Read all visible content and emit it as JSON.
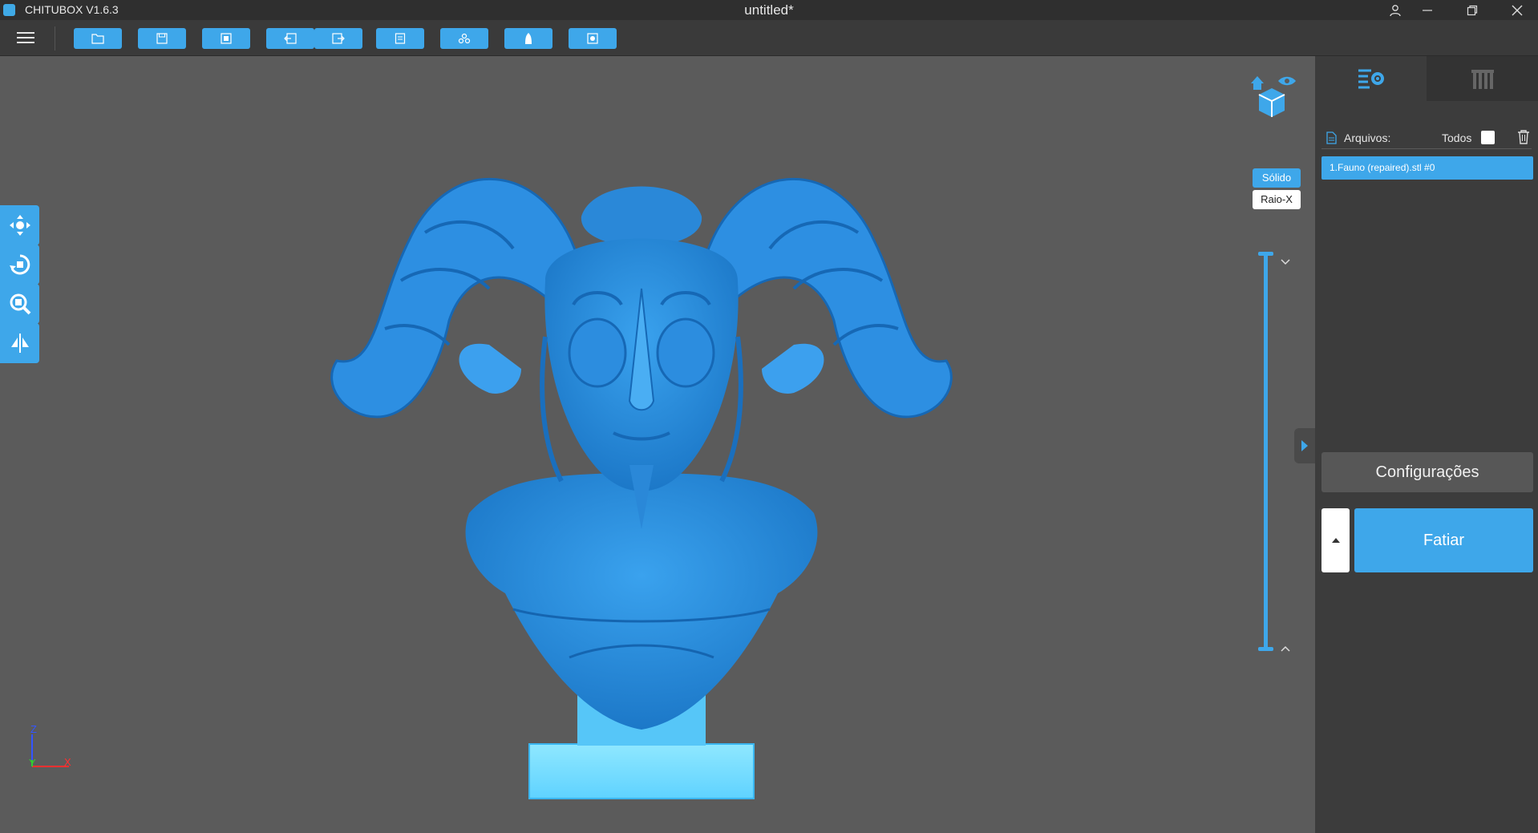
{
  "window": {
    "app_title": "CHITUBOX V1.6.3",
    "document_title": "untitled*"
  },
  "toolbar": {
    "buttons": [
      {
        "name": "open-file",
        "icon": "folder-icon"
      },
      {
        "name": "save-file",
        "icon": "save-icon"
      },
      {
        "name": "auto-layout",
        "icon": "frame-icon"
      },
      {
        "name": "undo",
        "icon": "undo-icon"
      },
      {
        "name": "redo",
        "icon": "redo-icon"
      },
      {
        "name": "list",
        "icon": "list-icon"
      },
      {
        "name": "multiply",
        "icon": "copies-icon"
      },
      {
        "name": "hollow",
        "icon": "hollow-icon"
      },
      {
        "name": "dig-hole",
        "icon": "hole-icon"
      }
    ]
  },
  "left_tools": [
    "move-icon",
    "rotate-icon",
    "scale-icon",
    "mirror-icon"
  ],
  "view_modes": {
    "solid": "Sólido",
    "xray": "Raio-X",
    "active": "solid"
  },
  "files_panel": {
    "label": "Arquivos:",
    "select_all_label": "Todos",
    "select_all_checked": false,
    "items": [
      {
        "label": "1.Fauno (repaired).stl #0",
        "selected": true
      }
    ]
  },
  "actions": {
    "settings_label": "Configurações",
    "slice_label": "Fatiar"
  },
  "axis_labels": {
    "z": "Z",
    "y": "Y",
    "x": "X"
  },
  "colors": {
    "accent": "#3ea7ea",
    "model": "#2f8fe0",
    "background": "#5b5b5b",
    "panel": "#3c3c3c"
  }
}
